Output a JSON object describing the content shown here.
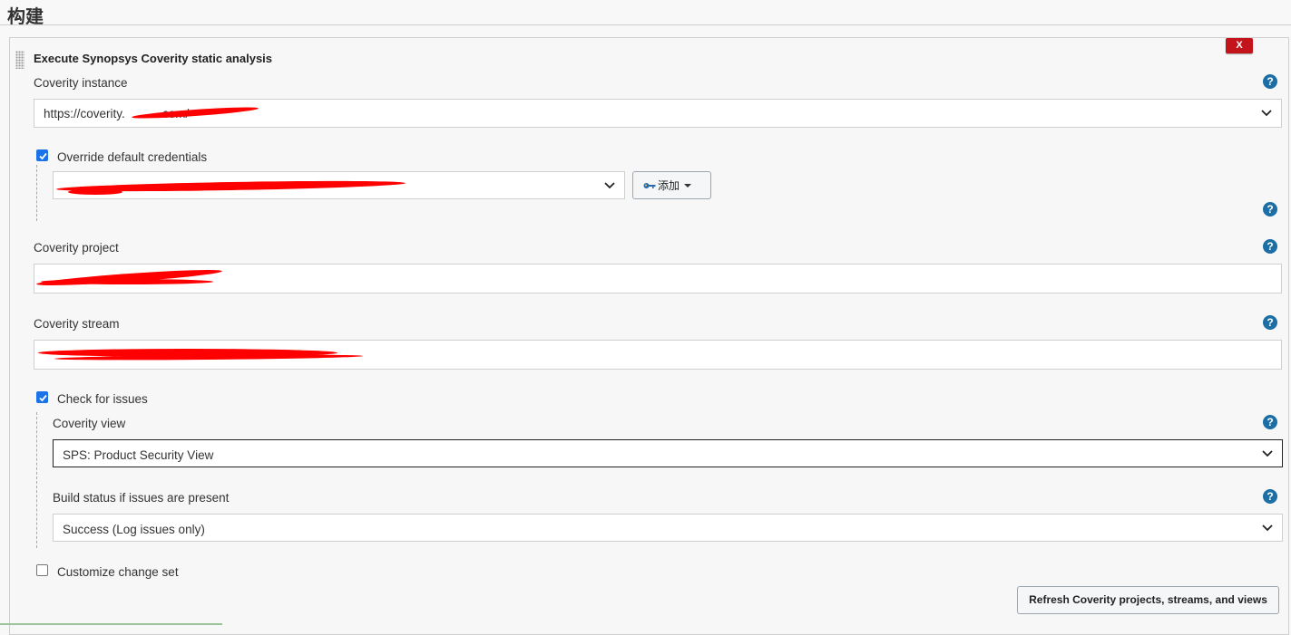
{
  "section": {
    "title": "构建"
  },
  "step": {
    "title": "Execute Synopsys Coverity static analysis",
    "delete_label": "X"
  },
  "coverity_instance": {
    "label": "Coverity instance",
    "value": "https://coverity.          .com/"
  },
  "credentials": {
    "override_label": "Override default credentials",
    "override_checked": true,
    "selected": "",
    "add_label": "添加"
  },
  "coverity_project": {
    "label": "Coverity project",
    "value": ""
  },
  "coverity_stream": {
    "label": "Coverity stream",
    "value": ""
  },
  "check_issues": {
    "label": "Check for issues",
    "checked": true
  },
  "coverity_view": {
    "label": "Coverity view",
    "value": "SPS: Product Security View"
  },
  "build_status": {
    "label": "Build status if issues are present",
    "value": "Success (Log issues only)"
  },
  "customize_change_set": {
    "label": "Customize change set",
    "checked": false
  },
  "refresh": {
    "label": "Refresh Coverity projects, streams, and views"
  },
  "help_label": "?",
  "colors": {
    "help": "#1c6ea4",
    "delete": "#c4141b",
    "checkbox": "#1a73e8",
    "redaction": "#ff0000"
  }
}
